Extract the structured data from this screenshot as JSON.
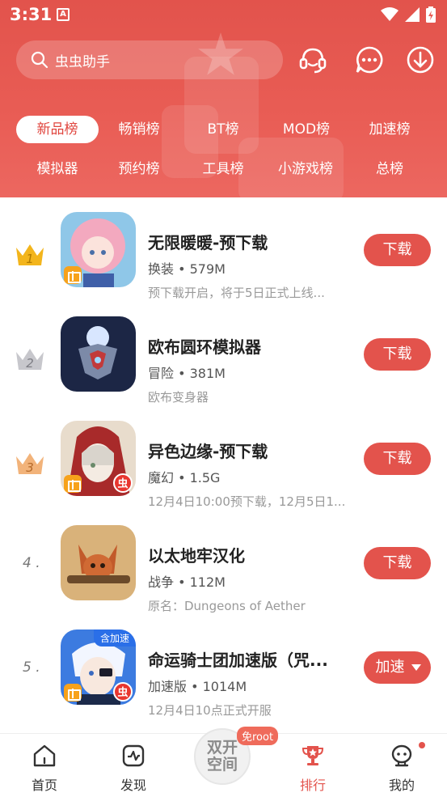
{
  "status_bar": {
    "time": "3:31",
    "app_badge": "A"
  },
  "search": {
    "placeholder": "虫虫助手"
  },
  "header_actions": {
    "support": "customer-service-icon",
    "message": "message-icon",
    "download": "download-icon"
  },
  "tabs": {
    "row1": [
      "新品榜",
      "畅销榜",
      "BT榜",
      "MOD榜",
      "加速榜"
    ],
    "row2": [
      "模拟器",
      "预约榜",
      "工具榜",
      "小游戏榜",
      "总榜"
    ],
    "active": "新品榜"
  },
  "list": [
    {
      "rank": "1",
      "title": "无限暖暖-预下载",
      "meta": "换装 • 579M",
      "desc": "预下载开启，将于5日正式上线...",
      "button": "下载"
    },
    {
      "rank": "2",
      "title": "欧布圆环模拟器",
      "meta": "冒险 • 381M",
      "desc": "欧布变身器",
      "button": "下载"
    },
    {
      "rank": "3",
      "title": "异色边缘-预下载",
      "meta": "魔幻 • 1.5G",
      "desc": "12月4日10:00预下载，12月5日1...",
      "button": "下载",
      "badge": "虫"
    },
    {
      "rank": "4 .",
      "title": "以太地牢汉化",
      "meta": "战争 • 112M",
      "desc": "原名：Dungeons of Aether",
      "button": "下载"
    },
    {
      "rank": "5 .",
      "title": "命运骑士团加速版（咒...",
      "meta": "加速版 • 1014M",
      "desc": "12月4日10点正式开服",
      "button": "加速",
      "badge": "虫",
      "corner_tag": "含加速"
    }
  ],
  "bottom_nav": {
    "home": "首页",
    "discover": "发现",
    "center_line1": "双开",
    "center_line2": "空间",
    "root_tag": "免root",
    "rank": "排行",
    "mine": "我的"
  },
  "colors": {
    "accent": "#e3534c",
    "header": "#e95d55"
  }
}
